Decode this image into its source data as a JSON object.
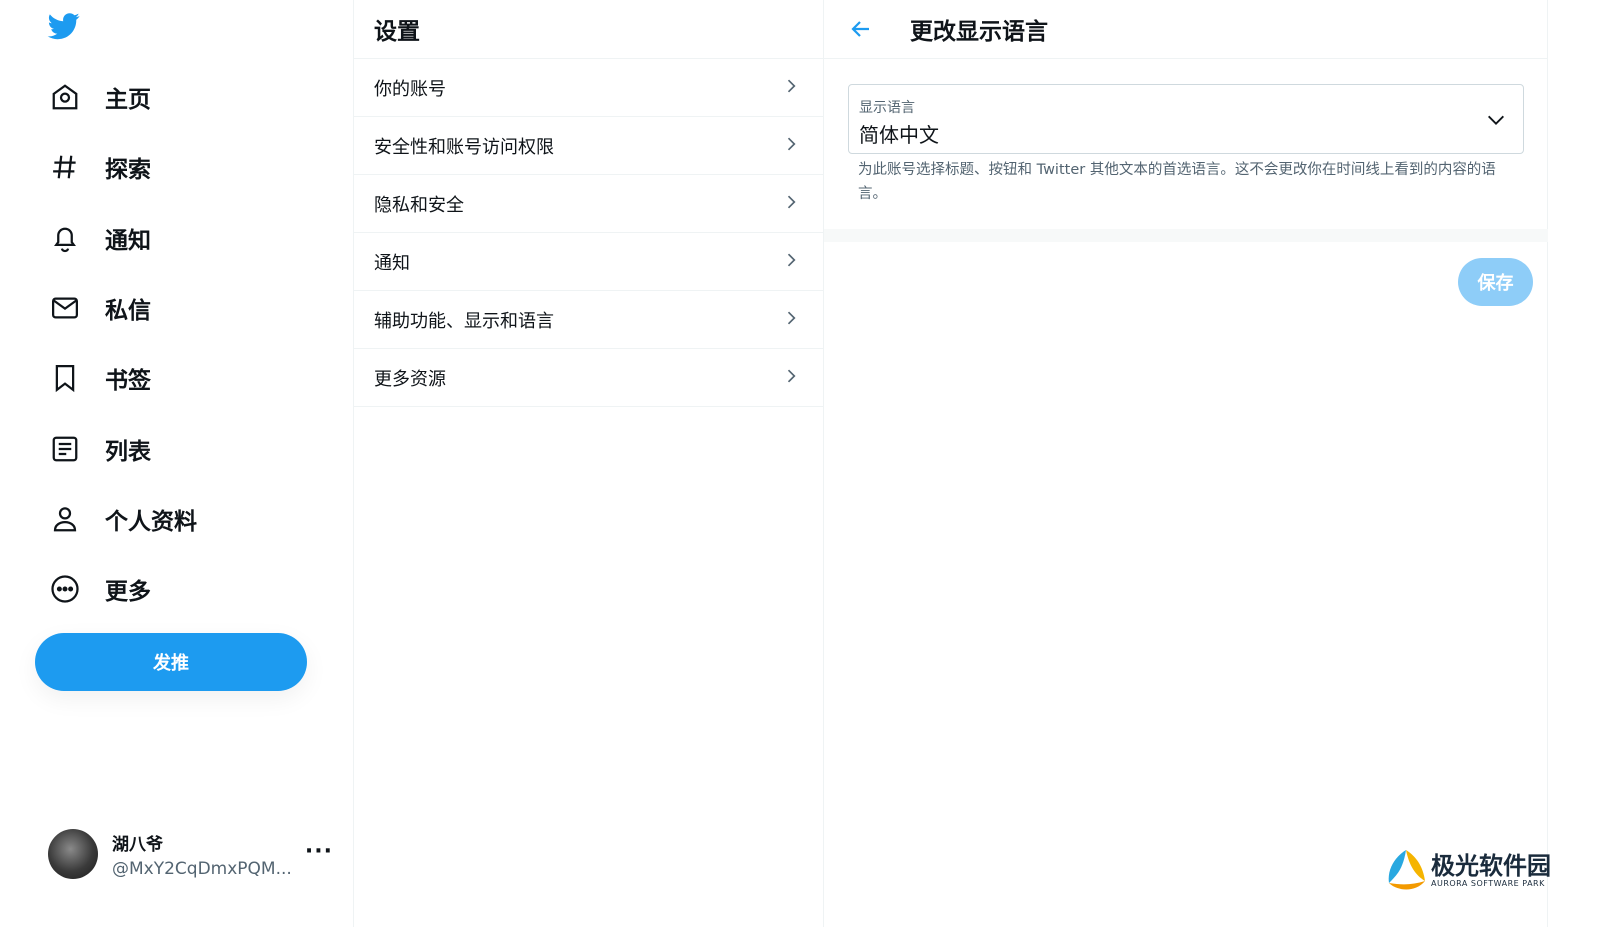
{
  "nav": {
    "items": [
      {
        "label": "主页",
        "icon": "home-icon"
      },
      {
        "label": "探索",
        "icon": "hashtag-icon"
      },
      {
        "label": "通知",
        "icon": "bell-icon"
      },
      {
        "label": "私信",
        "icon": "mail-icon"
      },
      {
        "label": "书签",
        "icon": "bookmark-icon"
      },
      {
        "label": "列表",
        "icon": "list-icon"
      },
      {
        "label": "个人资料",
        "icon": "profile-icon"
      },
      {
        "label": "更多",
        "icon": "more-circle-icon"
      }
    ],
    "tweet_button": "发推"
  },
  "account": {
    "name": "湖八爷",
    "handle": "@MxY2CqDmxPQM...",
    "more": "···"
  },
  "settings": {
    "title": "设置",
    "items": [
      "你的账号",
      "安全性和账号访问权限",
      "隐私和安全",
      "通知",
      "辅助功能、显示和语言",
      "更多资源"
    ]
  },
  "detail": {
    "title": "更改显示语言",
    "select_label": "显示语言",
    "select_value": "简体中文",
    "help_text": "为此账号选择标题、按钮和 Twitter 其他文本的首选语言。这不会更改你在时间线上看到的内容的语言。",
    "save_label": "保存"
  },
  "watermark": {
    "cn": "极光软件园",
    "en": "AURORA SOFTWARE PARK"
  },
  "colors": {
    "accent": "#1d9bf0",
    "accent_disabled": "#8ecdf8",
    "text": "#0f1419",
    "muted": "#536471",
    "border": "#eff3f4"
  }
}
